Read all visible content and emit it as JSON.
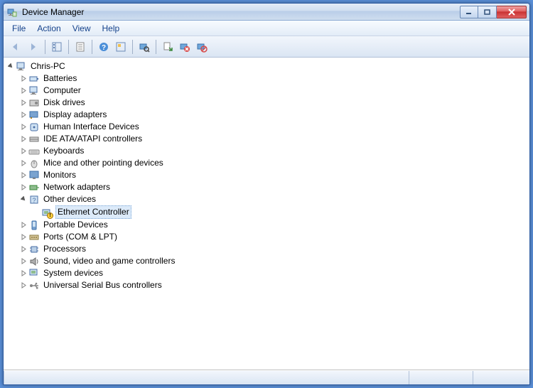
{
  "window": {
    "title": "Device Manager"
  },
  "menu": {
    "file": "File",
    "action": "Action",
    "view": "View",
    "help": "Help"
  },
  "tree": {
    "root": "Chris-PC",
    "categories": [
      "Batteries",
      "Computer",
      "Disk drives",
      "Display adapters",
      "Human Interface Devices",
      "IDE ATA/ATAPI controllers",
      "Keyboards",
      "Mice and other pointing devices",
      "Monitors",
      "Network adapters",
      "Other devices",
      "Portable Devices",
      "Ports (COM & LPT)",
      "Processors",
      "Sound, video and game controllers",
      "System devices",
      "Universal Serial Bus controllers"
    ],
    "other_device_child": "Ethernet Controller"
  }
}
